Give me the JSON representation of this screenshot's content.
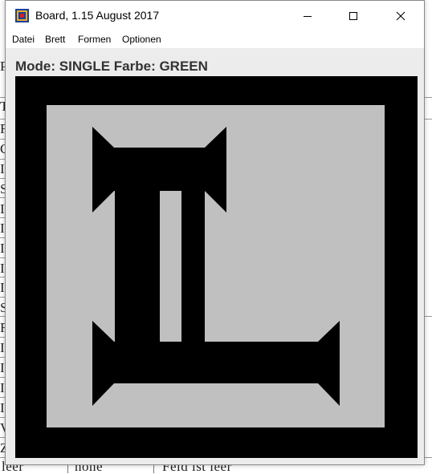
{
  "window": {
    "title": "Board, 1.15 August 2017",
    "controls": {
      "minimize": "minimize",
      "maximize": "maximize",
      "close": "close"
    }
  },
  "menu": {
    "items": [
      {
        "label": "Datei"
      },
      {
        "label": "Brett"
      },
      {
        "label": "Formen"
      },
      {
        "label": "Optionen"
      }
    ]
  },
  "status": {
    "mode_text": "Mode: SINGLE Farbe: GREEN"
  },
  "board": {
    "background": "#000000",
    "field_color": "#c0c0c0",
    "shape_color": "#000000"
  },
  "background_document": {
    "row_initials": [
      "P",
      "T",
      "F",
      "C",
      "I",
      "S",
      "I",
      "I",
      "I",
      "I",
      "I",
      "S",
      "F",
      "I",
      "I",
      "I",
      "I",
      "V",
      "Z"
    ],
    "bottom_row": [
      "leer",
      "none",
      "Feld ist leer"
    ]
  },
  "colors": {
    "window_bg": "#f0f0f0",
    "titlebar_bg": "#ffffff",
    "mode_text": "#333333"
  }
}
